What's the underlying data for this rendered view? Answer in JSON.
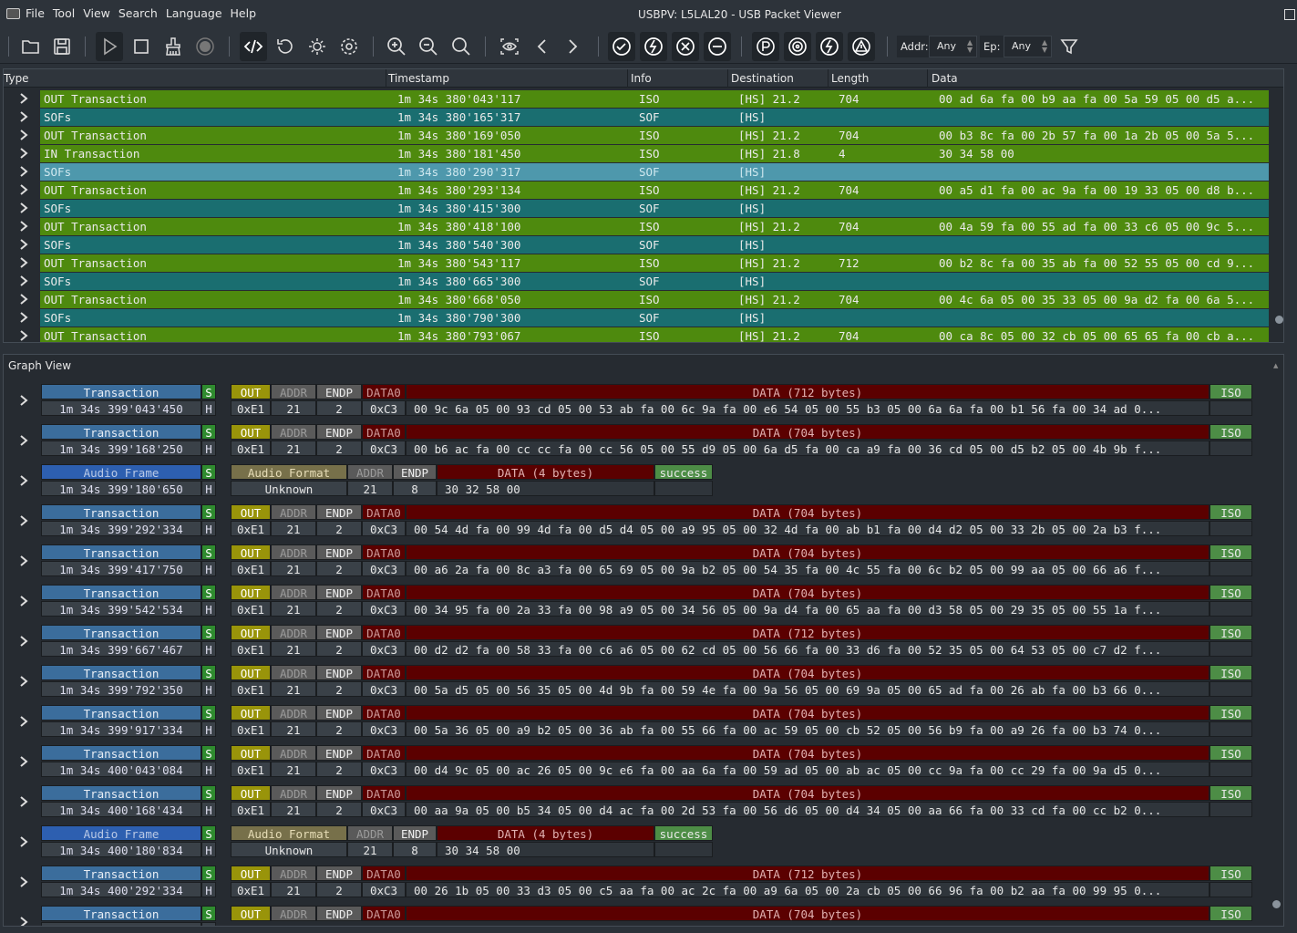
{
  "window": {
    "title": "USBPV: L5LAL20 - USB Packet Viewer"
  },
  "menu": [
    "File",
    "Tool",
    "View",
    "Search",
    "Language",
    "Help"
  ],
  "toolbar": {
    "addr_label": "Addr:",
    "addr_value": "Any",
    "ep_label": "Ep:",
    "ep_value": "Any"
  },
  "table": {
    "columns": [
      "Type",
      "Timestamp",
      "Info",
      "Destination",
      "Length",
      "Data"
    ],
    "rows": [
      {
        "type": "OUT Transaction",
        "ts": "1m 34s 380'043'117",
        "info": "ISO",
        "dest": "[HS] 21.2",
        "len": "704",
        "data": "00 ad 6a fa 00 b9 aa fa 00 5a 59 05 00 d5 a...",
        "kind": "out"
      },
      {
        "type": "SOFs",
        "ts": "1m 34s 380'165'317",
        "info": "SOF",
        "dest": "[HS]",
        "len": "",
        "data": "",
        "kind": "sof"
      },
      {
        "type": "OUT Transaction",
        "ts": "1m 34s 380'169'050",
        "info": "ISO",
        "dest": "[HS] 21.2",
        "len": "704",
        "data": "00 b3 8c fa 00 2b 57 fa 00 1a 2b 05 00 5a 5...",
        "kind": "out"
      },
      {
        "type": "IN Transaction",
        "ts": "1m 34s 380'181'450",
        "info": "ISO",
        "dest": "[HS] 21.8",
        "len": "4",
        "data": "30 34 58 00",
        "kind": "out"
      },
      {
        "type": "SOFs",
        "ts": "1m 34s 380'290'317",
        "info": "SOF",
        "dest": "[HS]",
        "len": "",
        "data": "",
        "kind": "sel"
      },
      {
        "type": "OUT Transaction",
        "ts": "1m 34s 380'293'134",
        "info": "ISO",
        "dest": "[HS] 21.2",
        "len": "704",
        "data": "00 a5 d1 fa 00 ac 9a fa 00 19 33 05 00 d8 b...",
        "kind": "out"
      },
      {
        "type": "SOFs",
        "ts": "1m 34s 380'415'300",
        "info": "SOF",
        "dest": "[HS]",
        "len": "",
        "data": "",
        "kind": "sof"
      },
      {
        "type": "OUT Transaction",
        "ts": "1m 34s 380'418'100",
        "info": "ISO",
        "dest": "[HS] 21.2",
        "len": "704",
        "data": "00 4a 59 fa 00 55 ad fa 00 33 c6 05 00 9c 5...",
        "kind": "out"
      },
      {
        "type": "SOFs",
        "ts": "1m 34s 380'540'300",
        "info": "SOF",
        "dest": "[HS]",
        "len": "",
        "data": "",
        "kind": "sof"
      },
      {
        "type": "OUT Transaction",
        "ts": "1m 34s 380'543'117",
        "info": "ISO",
        "dest": "[HS] 21.2",
        "len": "712",
        "data": "00 b2 8c fa 00 35 ab fa 00 52 55 05 00 cd 9...",
        "kind": "out"
      },
      {
        "type": "SOFs",
        "ts": "1m 34s 380'665'300",
        "info": "SOF",
        "dest": "[HS]",
        "len": "",
        "data": "",
        "kind": "sof"
      },
      {
        "type": "OUT Transaction",
        "ts": "1m 34s 380'668'050",
        "info": "ISO",
        "dest": "[HS] 21.2",
        "len": "704",
        "data": "00 4c 6a 05 00 35 33 05 00 9a d2 fa 00 6a 5...",
        "kind": "out"
      },
      {
        "type": "SOFs",
        "ts": "1m 34s 380'790'300",
        "info": "SOF",
        "dest": "[HS]",
        "len": "",
        "data": "",
        "kind": "sof"
      },
      {
        "type": "OUT Transaction",
        "ts": "1m 34s 380'793'067",
        "info": "ISO",
        "dest": "[HS] 21.2",
        "len": "704",
        "data": "00 ca 8c 05 00 32 cb 05 00 65 65 fa 00 cb a...",
        "kind": "out"
      }
    ]
  },
  "graph": {
    "title": "Graph View",
    "labels": {
      "s": "S",
      "h": "H",
      "out": "OUT",
      "addr": "ADDR",
      "endp": "ENDP",
      "data0": "DATA0",
      "iso": "ISO",
      "pid": "0xE1",
      "addr_v": "21",
      "endp_v": "2",
      "data_pid": "0xC3",
      "audio_format": "Audio Format",
      "unknown": "Unknown",
      "success": "success"
    },
    "items": [
      {
        "kind": "tx",
        "name": "Transaction",
        "ts": "1m 34s 399'043'450",
        "hdr": "DATA (712 bytes)",
        "bytes": "00 9c 6a 05 00 93 cd 05 00 53 ab fa 00 6c 9a fa 00 e6 54 05 00 55 b3 05 00 6a 6a fa 00 b1 56 fa 00 34 ad 0..."
      },
      {
        "kind": "tx",
        "name": "Transaction",
        "ts": "1m 34s 399'168'250",
        "hdr": "DATA (704 bytes)",
        "bytes": "00 b6 ac fa 00 cc cc fa 00 cc 56 05 00 55 d9 05 00 6a d5 fa 00 ca a9 fa 00 36 cd 05 00 d5 b2 05 00 4b 9b f..."
      },
      {
        "kind": "audio",
        "name": "Audio Frame",
        "ts": "1m 34s 399'180'650",
        "hdr": "DATA (4 bytes)",
        "bytes": "30 32 58 00",
        "addr": "21",
        "endp": "8"
      },
      {
        "kind": "tx",
        "name": "Transaction",
        "ts": "1m 34s 399'292'334",
        "hdr": "DATA (704 bytes)",
        "bytes": "00 54 4d fa 00 99 4d fa 00 d5 d4 05 00 a9 95 05 00 32 4d fa 00 ab b1 fa 00 d4 d2 05 00 33 2b 05 00 2a b3 f..."
      },
      {
        "kind": "tx",
        "name": "Transaction",
        "ts": "1m 34s 399'417'750",
        "hdr": "DATA (704 bytes)",
        "bytes": "00 a6 2a fa 00 8c a3 fa 00 65 69 05 00 9a b2 05 00 54 35 fa 00 4c 55 fa 00 6c b2 05 00 99 aa 05 00 66 a6 f..."
      },
      {
        "kind": "tx",
        "name": "Transaction",
        "ts": "1m 34s 399'542'534",
        "hdr": "DATA (704 bytes)",
        "bytes": "00 34 95 fa 00 2a 33 fa 00 98 a9 05 00 34 56 05 00 9a d4 fa 00 65 aa fa 00 d3 58 05 00 29 35 05 00 55 1a f..."
      },
      {
        "kind": "tx",
        "name": "Transaction",
        "ts": "1m 34s 399'667'467",
        "hdr": "DATA (712 bytes)",
        "bytes": "00 d2 d2 fa 00 58 33 fa 00 c6 a6 05 00 62 cd 05 00 56 66 fa 00 33 d6 fa 00 52 35 05 00 64 53 05 00 c7 d2 f..."
      },
      {
        "kind": "tx",
        "name": "Transaction",
        "ts": "1m 34s 399'792'350",
        "hdr": "DATA (704 bytes)",
        "bytes": "00 5a d5 05 00 56 35 05 00 4d 9b fa 00 59 4e fa 00 9a 56 05 00 69 9a 05 00 65 ad fa 00 26 ab fa 00 b3 66 0..."
      },
      {
        "kind": "tx",
        "name": "Transaction",
        "ts": "1m 34s 399'917'334",
        "hdr": "DATA (704 bytes)",
        "bytes": "00 5a 36 05 00 a9 b2 05 00 36 ab fa 00 55 66 fa 00 ac 59 05 00 cb 52 05 00 56 b9 fa 00 a9 26 fa 00 b3 74 0..."
      },
      {
        "kind": "tx",
        "name": "Transaction",
        "ts": "1m 34s 400'043'084",
        "hdr": "DATA (704 bytes)",
        "bytes": "00 d4 9c 05 00 ac 26 05 00 9c e6 fa 00 aa 6a fa 00 59 ad 05 00 ab ac 05 00 cc 9a fa 00 cc 29 fa 00 9a d5 0..."
      },
      {
        "kind": "tx",
        "name": "Transaction",
        "ts": "1m 34s 400'168'434",
        "hdr": "DATA (704 bytes)",
        "bytes": "00 aa 9a 05 00 b5 34 05 00 d4 ac fa 00 2d 53 fa 00 56 d6 05 00 d4 34 05 00 aa 66 fa 00 33 cd fa 00 cc b2 0..."
      },
      {
        "kind": "audio",
        "name": "Audio Frame",
        "ts": "1m 34s 400'180'834",
        "hdr": "DATA (4 bytes)",
        "bytes": "30 34 58 00",
        "addr": "21",
        "endp": "8"
      },
      {
        "kind": "tx",
        "name": "Transaction",
        "ts": "1m 34s 400'292'334",
        "hdr": "DATA (712 bytes)",
        "bytes": "00 26 1b 05 00 33 d3 05 00 c5 aa fa 00 ac 2c fa 00 a9 6a 05 00 2a cb 05 00 66 96 fa 00 b2 aa fa 00 99 95 0..."
      },
      {
        "kind": "tx",
        "name": "Transaction",
        "ts": "",
        "hdr": "DATA (704 bytes)",
        "bytes": ""
      }
    ]
  },
  "colors": {
    "row_out": "#4e8a0e",
    "row_sof": "#1a6e70",
    "row_selected": "#4e98ac",
    "name_bg": "#3b6d9c",
    "audio_bg": "#2d5fb0",
    "s_bg": "#2f8b2f",
    "out_bg": "#99940a",
    "data_hdr": "#5b0000",
    "data_body": "#2a0000",
    "iso": "#4d8d46"
  }
}
